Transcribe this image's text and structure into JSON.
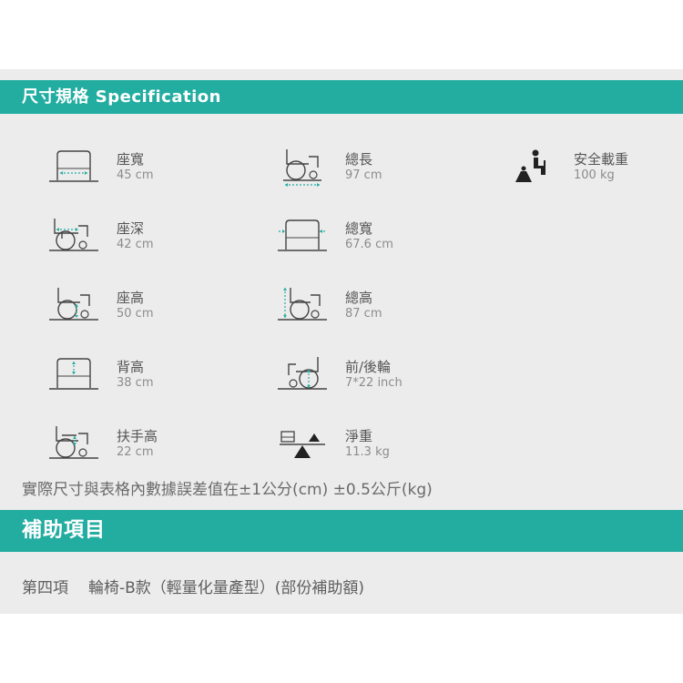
{
  "spec_header": "尺寸規格 Specification",
  "specs": {
    "seat_width": {
      "name": "座寬",
      "value": "45 cm",
      "icon": "seat-width-icon"
    },
    "seat_depth": {
      "name": "座深",
      "value": "42 cm",
      "icon": "seat-depth-icon"
    },
    "seat_height": {
      "name": "座高",
      "value": "50 cm",
      "icon": "seat-height-icon"
    },
    "back_height": {
      "name": "背高",
      "value": "38 cm",
      "icon": "back-height-icon"
    },
    "arm_height": {
      "name": "扶手高",
      "value": "22 cm",
      "icon": "armrest-height-icon"
    },
    "total_length": {
      "name": "總長",
      "value": "97 cm",
      "icon": "total-length-icon"
    },
    "total_width": {
      "name": "總寬",
      "value": "67.6 cm",
      "icon": "total-width-icon"
    },
    "total_height": {
      "name": "總高",
      "value": "87 cm",
      "icon": "total-height-icon"
    },
    "wheels": {
      "name": "前/後輪",
      "value": "7*22 inch",
      "icon": "wheel-size-icon"
    },
    "net_weight": {
      "name": "淨重",
      "value": "11.3 kg",
      "icon": "net-weight-icon"
    },
    "safe_load": {
      "name": "安全載重",
      "value": "100 kg",
      "icon": "safe-load-icon"
    }
  },
  "note": "實際尺寸與表格內數據誤差值在±1公分(cm) ±0.5公斤(kg)",
  "subsidy_header": "補助項目",
  "subsidy": {
    "item_no": "第四項",
    "item_name": "輪椅-B款（輕量化量產型）(部份補助額)"
  },
  "colors": {
    "accent": "#23ada1",
    "panel": "#ececec",
    "guide": "#23ada1",
    "line": "#444444"
  }
}
